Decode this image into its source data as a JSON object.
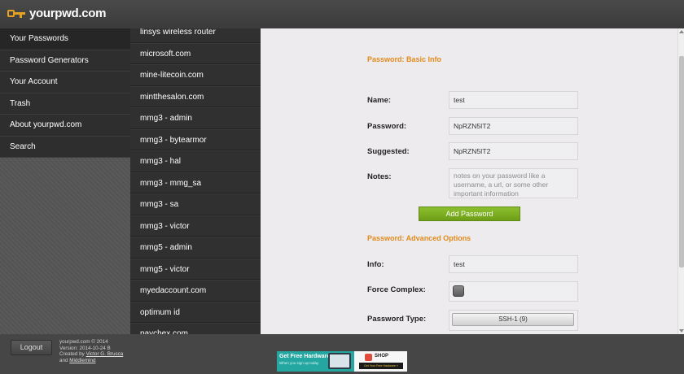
{
  "brand": {
    "logo_text": "yourpwd.com",
    "accent": "#e8a020"
  },
  "left_menu": [
    {
      "label": "Your Passwords",
      "active": true
    },
    {
      "label": "Password Generators"
    },
    {
      "label": "Your Account"
    },
    {
      "label": "Trash"
    },
    {
      "label": "About yourpwd.com"
    },
    {
      "label": "Search"
    }
  ],
  "password_list": [
    "linsys wireless router",
    "microsoft.com",
    "mine-litecoin.com",
    "mintthesalon.com",
    "mmg3 - admin",
    "mmg3 - bytearmor",
    "mmg3 - hal",
    "mmg3 - mmg_sa",
    "mmg3 - sa",
    "mmg3 - victor",
    "mmg5 - admin",
    "mmg5 - victor",
    "myedaccount.com",
    "optimum id",
    "paychex.com"
  ],
  "form": {
    "basic_title": "Password: Basic Info",
    "name_label": "Name:",
    "name_value": "test",
    "password_label": "Password:",
    "password_value": "NpRZN5IT2",
    "suggested_label": "Suggested:",
    "suggested_value": "NpRZN5IT2",
    "notes_label": "Notes:",
    "notes_placeholder": "notes on your password like a username, a url, or some other important information",
    "add_button": "Add Password",
    "advanced_title": "Password: Advanced Options",
    "info_label": "Info:",
    "info_value": "test",
    "force_label": "Force Complex:",
    "type_label": "Password Type:",
    "type_value": "SSH-1 (9)"
  },
  "footer": {
    "logout": "Logout",
    "line1": "yourpwd.com © 2014",
    "line2": "Version: 2014-10-24 B",
    "created_by": "Created by",
    "author": "Victor G. Brusca",
    "and": "and",
    "company": "Middlemind"
  },
  "ad": {
    "title": "Get Free Hardware",
    "subtitle": "When you sign up today",
    "shop": "SHOP",
    "cta": "Get Your Free Hardware »"
  }
}
